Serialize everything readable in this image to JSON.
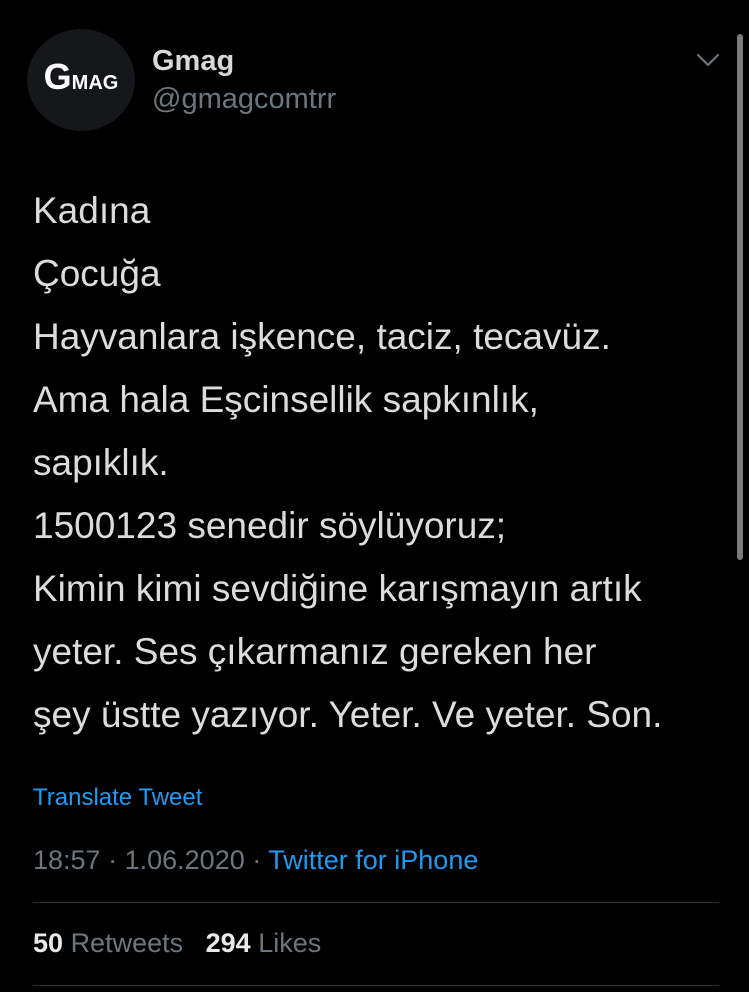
{
  "tweet": {
    "author": {
      "display_name": "Gmag",
      "handle": "@gmagcomtrr",
      "avatar_logo_big": "G",
      "avatar_logo_small": "MAG"
    },
    "menu_icon": "chevron-down-icon",
    "lines": [
      "Kadına",
      "Çocuğa",
      "Hayvanlara işkence, taciz, tecavüz.",
      "Ama hala Eşcinsellik sapkınlık,",
      "sapıklık.",
      "1500123 senedir söylüyoruz;",
      "Kimin kimi sevdiğine karışmayın artık",
      "yeter. Ses çıkarmanız gereken her",
      "şey üstte yazıyor. Yeter. Ve yeter. Son."
    ],
    "translate_label": "Translate Tweet",
    "time": "18:57",
    "separator": "·",
    "date": "1.06.2020",
    "source": "Twitter for iPhone",
    "retweets_count": "50",
    "retweets_label": "Retweets",
    "likes_count": "294",
    "likes_label": "Likes"
  },
  "colors": {
    "background": "#000000",
    "link": "#1d9bf0",
    "muted": "#6e767d",
    "text": "#dcdcdc"
  }
}
